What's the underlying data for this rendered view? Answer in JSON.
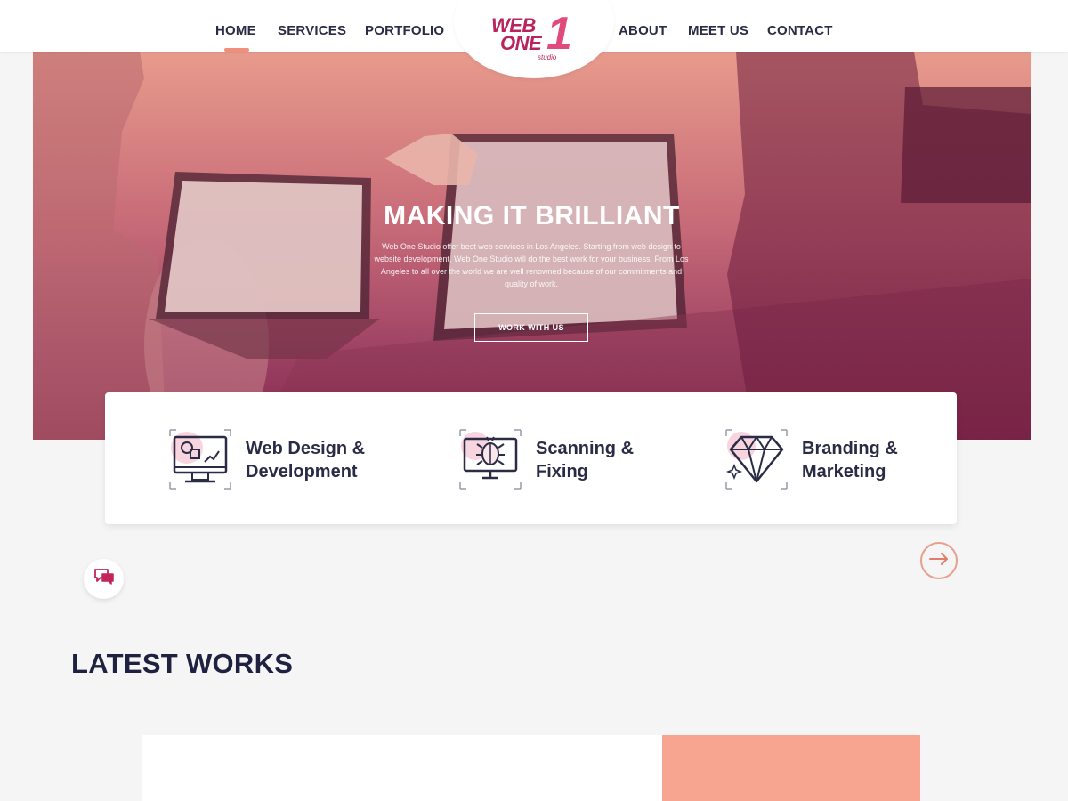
{
  "header": {
    "nav_left": [
      "HOME",
      "SERVICES",
      "PORTFOLIO"
    ],
    "nav_right": [
      "ABOUT",
      "MEET US",
      "CONTACT"
    ],
    "logo": {
      "line1": "WEB",
      "line2": "ONE",
      "mark": "1",
      "tagline": "studio"
    },
    "active_item": "HOME"
  },
  "hero": {
    "title": "MAKING IT BRILLIANT",
    "description": "Web One Studio offer best web services in Los Angeles. Starting from web design to website development, Web One Studio will do the best work for your business. From Los Angeles to all over the world we are well renowned because of our commitments and quality of work.",
    "cta": "WORK WITH US"
  },
  "services": [
    {
      "label": "Web Design & Development",
      "icon": "monitor-design-icon"
    },
    {
      "label": "Scanning & Fixing",
      "icon": "bug-scan-icon"
    },
    {
      "label": "Branding & Marketing",
      "icon": "diamond-icon"
    }
  ],
  "latest_works": {
    "title": "LATEST WORKS"
  },
  "colors": {
    "accent": "#f0907a",
    "brand": "#b8245e",
    "navy": "#1f2140",
    "peach": "#f7a491",
    "hero_top": "#e89b8c",
    "hero_bottom": "#82264e"
  },
  "icons": {
    "chat": "chat-bubbles-icon",
    "next": "arrow-right-icon"
  }
}
